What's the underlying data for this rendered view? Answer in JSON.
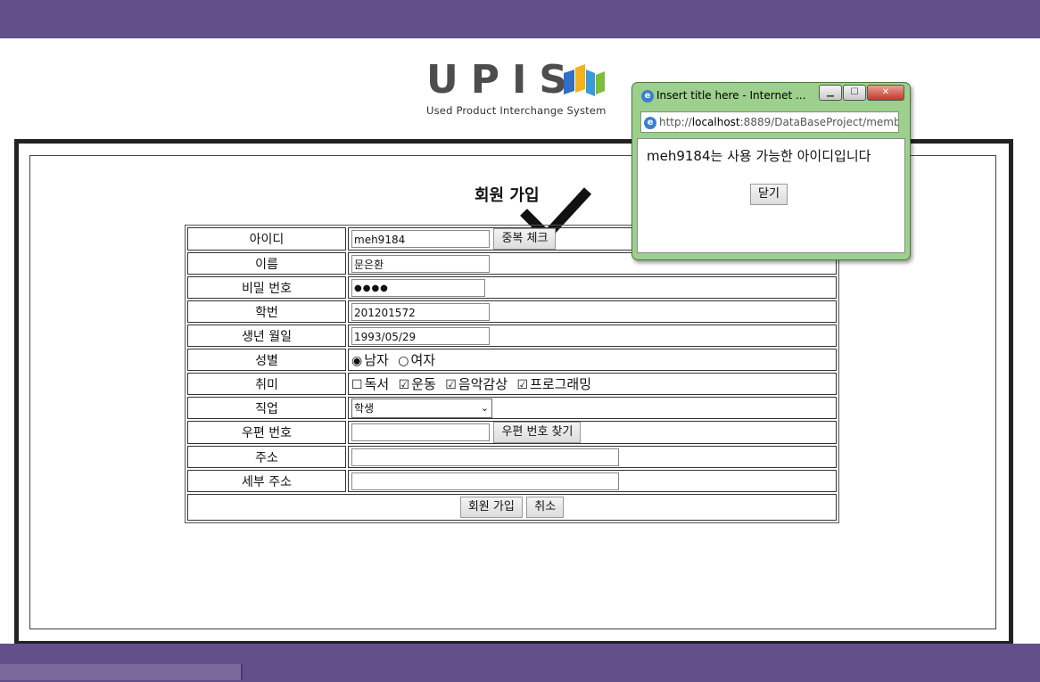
{
  "logo": {
    "text": "UPIS",
    "subtitle": "Used Product Interchange System"
  },
  "form": {
    "title": "회원 가입",
    "rows": [
      {
        "label": "아이디",
        "value": "meh9184",
        "button": "중복 체크"
      },
      {
        "label": "이름",
        "value": "문은환"
      },
      {
        "label": "비밀 번호",
        "value": "●●●●"
      },
      {
        "label": "학번",
        "value": "201201572"
      },
      {
        "label": "생년 월일",
        "value": "1993/05/29"
      },
      {
        "label": "성별",
        "options": [
          {
            "label": "남자",
            "checked": true
          },
          {
            "label": "여자",
            "checked": false
          }
        ]
      },
      {
        "label": "취미",
        "options": [
          {
            "label": "독서",
            "checked": false
          },
          {
            "label": "운동",
            "checked": true
          },
          {
            "label": "음악감상",
            "checked": true
          },
          {
            "label": "프로그래밍",
            "checked": true
          }
        ]
      },
      {
        "label": "직업",
        "selected": "학생"
      },
      {
        "label": "우편 번호",
        "value": "",
        "button": "우편 번호 찾기"
      },
      {
        "label": "주소",
        "value": ""
      },
      {
        "label": "세부 주소",
        "value": ""
      }
    ],
    "submit_label": "회원 가입",
    "cancel_label": "취소"
  },
  "popup": {
    "title": "Insert title here - Internet ...",
    "url_prefix": "http://",
    "url_host": "localhost",
    "url_rest": ":8889/DataBaseProject/memb",
    "message": "meh9184는 사용 가능한 아이디입니다",
    "close_label": "닫기"
  },
  "colors": {
    "banner": "#634f89",
    "popup_frame": "#9dd08c"
  }
}
